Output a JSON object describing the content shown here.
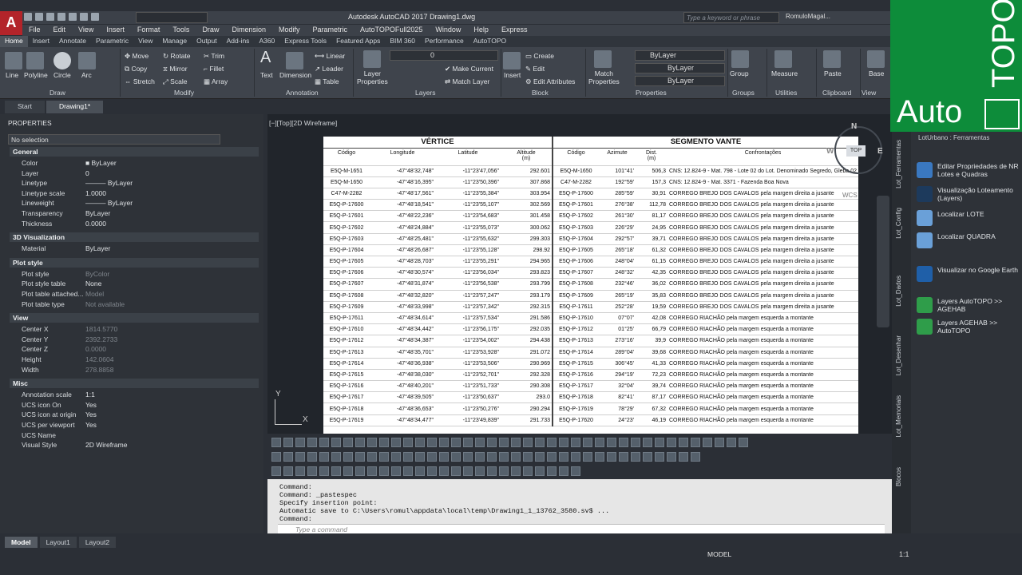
{
  "window": {
    "title": "Autodesk AutoCAD 2017    Drawing1.dwg",
    "search_placeholder": "Type a keyword or phrase",
    "user": "RomuloMagal...",
    "badge": "28"
  },
  "menu": [
    "File",
    "Edit",
    "View",
    "Insert",
    "Format",
    "Tools",
    "Draw",
    "Dimension",
    "Modify",
    "Parametric",
    "AutoTOPOFull2025",
    "Window",
    "Help",
    "Express"
  ],
  "ribbon_tabs": [
    "Home",
    "Insert",
    "Annotate",
    "Parametric",
    "View",
    "Manage",
    "Output",
    "Add-ins",
    "A360",
    "Express Tools",
    "Featured Apps",
    "BIM 360",
    "Performance",
    "AutoTOPO"
  ],
  "ribbon": {
    "draw": {
      "title": "Draw",
      "line": "Line",
      "polyline": "Polyline",
      "circle": "Circle",
      "arc": "Arc"
    },
    "modify": {
      "title": "Modify",
      "move": "Move",
      "rotate": "Rotate",
      "trim": "Trim",
      "copy": "Copy",
      "mirror": "Mirror",
      "fillet": "Fillet",
      "stretch": "Stretch",
      "scale": "Scale",
      "array": "Array"
    },
    "annotation": {
      "title": "Annotation",
      "text": "Text",
      "dimension": "Dimension",
      "linear": "Linear",
      "leader": "Leader",
      "table": "Table"
    },
    "layers": {
      "title": "Layers",
      "layer_properties": "Layer\nProperties",
      "current_layer": "0",
      "make_current": "Make Current",
      "match_layer": "Match Layer"
    },
    "block": {
      "title": "Block",
      "insert": "Insert",
      "create": "Create",
      "edit": "Edit",
      "edit_attributes": "Edit Attributes"
    },
    "properties": {
      "title": "Properties",
      "match_properties": "Match\nProperties",
      "color": "ByLayer",
      "linetype": "ByLayer",
      "lineweight": "ByLayer"
    },
    "groups": {
      "title": "Groups",
      "group": "Group"
    },
    "utilities": {
      "title": "Utilities",
      "measure": "Measure"
    },
    "clipboard": {
      "title": "Clipboard",
      "paste": "Paste"
    },
    "view": {
      "title": "View",
      "base": "Base"
    }
  },
  "doc_tabs": [
    "Start",
    "Drawing1*"
  ],
  "properties_panel": {
    "header": "PROPERTIES",
    "selection": "No selection",
    "sections": {
      "general": {
        "title": "General",
        "rows": [
          [
            "Color",
            "■ ByLayer"
          ],
          [
            "Layer",
            "0"
          ],
          [
            "Linetype",
            "——— ByLayer"
          ],
          [
            "Linetype scale",
            "1.0000"
          ],
          [
            "Lineweight",
            "——— ByLayer"
          ],
          [
            "Transparency",
            "ByLayer"
          ],
          [
            "Thickness",
            "0.0000"
          ]
        ]
      },
      "viz3d": {
        "title": "3D Visualization",
        "rows": [
          [
            "Material",
            "ByLayer"
          ]
        ]
      },
      "plot": {
        "title": "Plot style",
        "rows": [
          [
            "Plot style",
            "ByColor"
          ],
          [
            "Plot style table",
            "None"
          ],
          [
            "Plot table attached...",
            "Model"
          ],
          [
            "Plot table type",
            "Not available"
          ]
        ]
      },
      "view": {
        "title": "View",
        "rows": [
          [
            "Center X",
            "1814.5770"
          ],
          [
            "Center Y",
            "2392.2733"
          ],
          [
            "Center Z",
            "0.0000"
          ],
          [
            "Height",
            "142.0604"
          ],
          [
            "Width",
            "278.8858"
          ]
        ]
      },
      "misc": {
        "title": "Misc",
        "rows": [
          [
            "Annotation scale",
            "1:1"
          ],
          [
            "UCS icon On",
            "Yes"
          ],
          [
            "UCS icon at origin",
            "Yes"
          ],
          [
            "UCS per viewport",
            "Yes"
          ],
          [
            "UCS Name",
            ""
          ],
          [
            "Visual Style",
            "2D Wireframe"
          ]
        ]
      }
    }
  },
  "viewport": {
    "label": "[−][Top][2D Wireframe]",
    "compass_n": "N",
    "compass_e": "E",
    "compass_w": "W",
    "compass_top": "TOP",
    "ucs_label": "WCS"
  },
  "table": {
    "group_left": "VÉRTICE",
    "group_right": "SEGMENTO VANTE",
    "headers": [
      "Código",
      "Longitude",
      "Latitude",
      "Altitude\n(m)",
      "Código",
      "Azimute",
      "Dist.\n(m)",
      "Confrontações"
    ],
    "rows": [
      [
        "E5Q-M-1651",
        "-47°48'32,748\"",
        "-11°23'47,056\"",
        "292.601",
        "E5Q-M-1650",
        "101°41'",
        "506,3",
        "CNS: 12.824-9 - Mat. 798 - Lote 02 do Lot. Denominado Segredo, Gleba 02 L.E!"
      ],
      [
        "E5Q-M-1650",
        "-47°48'16,395\"",
        "-11°23'50,396\"",
        "307.868",
        "C47-M-2282",
        "192°59'",
        "157,3",
        "CNS: 12.824-9 - Mat. 3371 - Fazenda Boa Nova"
      ],
      [
        "C47-M-2282",
        "-47°48'17,561\"",
        "-11°23'55,384\"",
        "303.954",
        "E5Q-P-17600",
        "285°59'",
        "30,91",
        "CORREGO BREJO DOS CAVALOS pela margem direita a jusante"
      ],
      [
        "E5Q-P-17600",
        "-47°48'18,541\"",
        "-11°23'55,107\"",
        "302.569",
        "E5Q-P-17601",
        "276°38'",
        "112,78",
        "CORREGO BREJO DOS CAVALOS pela margem direita a jusante"
      ],
      [
        "E5Q-P-17601",
        "-47°48'22,236\"",
        "-11°23'54,683\"",
        "301.458",
        "E5Q-P-17602",
        "261°30'",
        "81,17",
        "CORREGO BREJO DOS CAVALOS pela margem direita a jusante"
      ],
      [
        "E5Q-P-17602",
        "-47°48'24,884\"",
        "-11°23'55,073\"",
        "300.062",
        "E5Q-P-17603",
        "226°29'",
        "24,95",
        "CORREGO BREJO DOS CAVALOS pela margem direita a jusante"
      ],
      [
        "E5Q-P-17603",
        "-47°48'25,481\"",
        "-11°23'55,632\"",
        "299.303",
        "E5Q-P-17604",
        "292°57'",
        "39,71",
        "CORREGO BREJO DOS CAVALOS pela margem direita a jusante"
      ],
      [
        "E5Q-P-17604",
        "-47°48'26,687\"",
        "-11°23'55,128\"",
        "298.92",
        "E5Q-P-17605",
        "265°18'",
        "61,32",
        "CORREGO BREJO DOS CAVALOS pela margem direita a jusante"
      ],
      [
        "E5Q-P-17605",
        "-47°48'28,703\"",
        "-11°23'55,291\"",
        "294.965",
        "E5Q-P-17606",
        "248°04'",
        "61,15",
        "CORREGO BREJO DOS CAVALOS pela margem direita a jusante"
      ],
      [
        "E5Q-P-17606",
        "-47°48'30,574\"",
        "-11°23'56,034\"",
        "293.823",
        "E5Q-P-17607",
        "248°32'",
        "42,35",
        "CORREGO BREJO DOS CAVALOS pela margem direita a jusante"
      ],
      [
        "E5Q-P-17607",
        "-47°48'31,874\"",
        "-11°23'56,538\"",
        "293.799",
        "E5Q-P-17608",
        "232°46'",
        "36,02",
        "CORREGO BREJO DOS CAVALOS pela margem direita a jusante"
      ],
      [
        "E5Q-P-17608",
        "-47°48'32,820\"",
        "-11°23'57,247\"",
        "293.179",
        "E5Q-P-17609",
        "265°19'",
        "35,83",
        "CORREGO BREJO DOS CAVALOS pela margem direita a jusante"
      ],
      [
        "E5Q-P-17609",
        "-47°48'33,998\"",
        "-11°23'57,342\"",
        "292.315",
        "E5Q-P-17611",
        "252°28'",
        "19,59",
        "CORREGO BREJO DOS CAVALOS pela margem direita a jusante"
      ],
      [
        "E5Q-P-17611",
        "-47°48'34,614\"",
        "-11°23'57,534\"",
        "291.586",
        "E5Q-P-17610",
        "07°07'",
        "42,08",
        "CORREGO RIACHÃO pela margem esquerda a montante"
      ],
      [
        "E5Q-P-17610",
        "-47°48'34,442\"",
        "-11°23'56,175\"",
        "292.035",
        "E5Q-P-17612",
        "01°25'",
        "66,79",
        "CORREGO RIACHÃO pela margem esquerda a montante"
      ],
      [
        "E5Q-P-17612",
        "-47°48'34,387\"",
        "-11°23'54,002\"",
        "294.438",
        "E5Q-P-17613",
        "273°16'",
        "39,9",
        "CORREGO RIACHÃO pela margem esquerda a montante"
      ],
      [
        "E5Q-P-17613",
        "-47°48'35,701\"",
        "-11°23'53,928\"",
        "291.072",
        "E5Q-P-17614",
        "289°04'",
        "39,68",
        "CORREGO RIACHÃO pela margem esquerda a montante"
      ],
      [
        "E5Q-P-17614",
        "-47°48'36,938\"",
        "-11°23'53,506\"",
        "290.969",
        "E5Q-P-17615",
        "306°45'",
        "41,33",
        "CORREGO RIACHÃO pela margem esquerda a montante"
      ],
      [
        "E5Q-P-17615",
        "-47°48'38,030\"",
        "-11°23'52,701\"",
        "292.328",
        "E5Q-P-17616",
        "294°19'",
        "72,23",
        "CORREGO RIACHÃO pela margem esquerda a montante"
      ],
      [
        "E5Q-P-17616",
        "-47°48'40,201\"",
        "-11°23'51,733\"",
        "290.308",
        "E5Q-P-17617",
        "32°04'",
        "39,74",
        "CORREGO RIACHÃO pela margem esquerda a montante"
      ],
      [
        "E5Q-P-17617",
        "-47°48'39,505\"",
        "-11°23'50,637\"",
        "293.0",
        "E5Q-P-17618",
        "82°41'",
        "87,17",
        "CORREGO RIACHÃO pela margem esquerda a montante"
      ],
      [
        "E5Q-P-17618",
        "-47°48'36,653\"",
        "-11°23'50,276\"",
        "290.294",
        "E5Q-P-17619",
        "78°29'",
        "67,32",
        "CORREGO RIACHÃO pela margem esquerda a montante"
      ],
      [
        "E5Q-P-17619",
        "-47°48'34,477\"",
        "-11°23'49,839\"",
        "291.733",
        "E5Q-P-17620",
        "24°23'",
        "46,19",
        "CORREGO RIACHÃO pela margem esquerda a montante"
      ]
    ]
  },
  "ucs": {
    "y": "Y",
    "x": "X"
  },
  "command": {
    "lines": [
      "Command:",
      "Command: _pastespec",
      "Specify insertion point:",
      "Automatic save to C:\\Users\\romul\\appdata\\local\\temp\\Drawing1_1_13762_3580.sv$ ...",
      "Command:"
    ],
    "placeholder": "Type a command"
  },
  "right_panel": {
    "title": "LotUrbano : Ferramentas",
    "vtabs": [
      "Lot_Ferramentas",
      "Lot_Config",
      "Lot_Dados",
      "Lot_Desenhar",
      "Lot_Memoriais",
      "Blocos"
    ],
    "items": [
      "Editar Propriedades de NR Lotes e Quadras",
      "Visualização Loteamento (Layers)",
      "Localizar LOTE",
      "Localizar QUADRA",
      "Visualizar no Google Earth",
      "Layers AutoTOPO >> AGEHAB",
      "Layers AGEHAB >> AutoTOPO"
    ]
  },
  "brand": {
    "line1": "Auto",
    "line2": "TOPO"
  },
  "layout_tabs": [
    "Model",
    "Layout1",
    "Layout2"
  ],
  "status": {
    "model": "MODEL",
    "scale": "1:1"
  }
}
